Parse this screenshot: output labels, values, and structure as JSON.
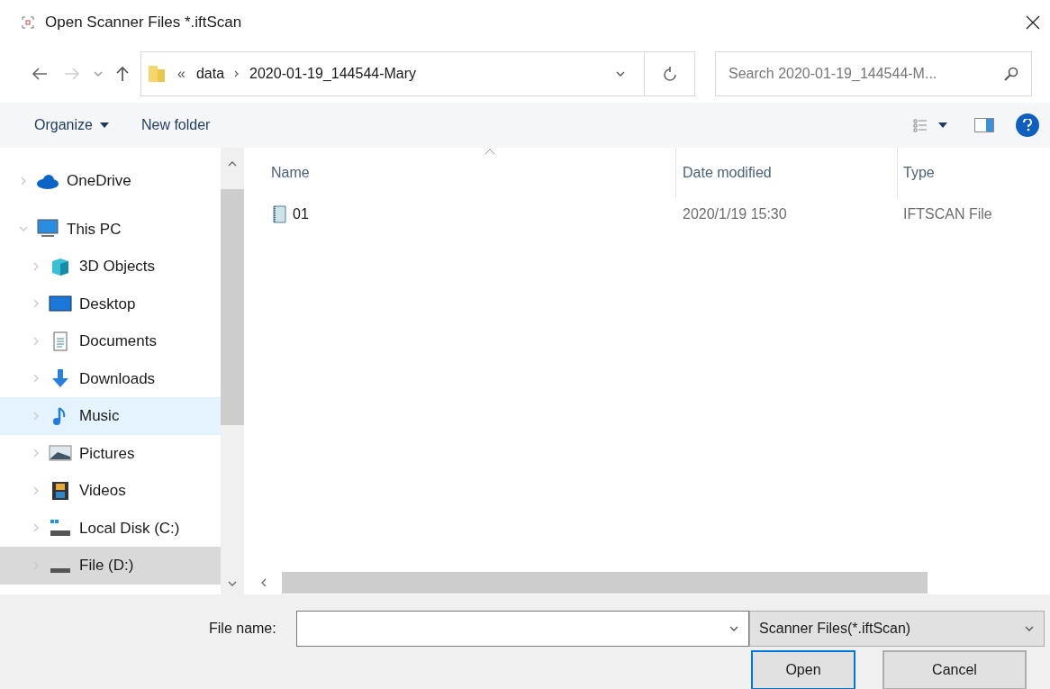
{
  "window": {
    "title": "Open Scanner Files *.iftScan"
  },
  "address_bar": {
    "overflow": "«",
    "breadcrumbs": [
      "data",
      "2020-01-19_144544-Mary"
    ]
  },
  "search": {
    "placeholder": "Search 2020-01-19_144544-M..."
  },
  "toolbar": {
    "organize": "Organize",
    "new_folder": "New folder"
  },
  "sidebar": {
    "items": [
      {
        "label": "OneDrive",
        "kind": "cloud",
        "expanded": false,
        "selected": false,
        "hovered": false
      },
      {
        "label": "This PC",
        "kind": "pc",
        "expanded": true,
        "selected": false,
        "hovered": false,
        "children": [
          {
            "label": "3D Objects",
            "kind": "cube",
            "expanded": false,
            "selected": false,
            "hovered": false
          },
          {
            "label": "Desktop",
            "kind": "desktop",
            "expanded": false,
            "selected": false,
            "hovered": false
          },
          {
            "label": "Documents",
            "kind": "document",
            "expanded": false,
            "selected": false,
            "hovered": false
          },
          {
            "label": "Downloads",
            "kind": "download",
            "expanded": false,
            "selected": false,
            "hovered": false
          },
          {
            "label": "Music",
            "kind": "music",
            "expanded": false,
            "selected": false,
            "hovered": true
          },
          {
            "label": "Pictures",
            "kind": "picture",
            "expanded": false,
            "selected": false,
            "hovered": false
          },
          {
            "label": "Videos",
            "kind": "video",
            "expanded": false,
            "selected": false,
            "hovered": false
          },
          {
            "label": "Local Disk (C:)",
            "kind": "system-drive",
            "expanded": false,
            "selected": false,
            "hovered": false
          },
          {
            "label": "File (D:)",
            "kind": "drive",
            "expanded": false,
            "selected": true,
            "hovered": false
          }
        ]
      }
    ]
  },
  "table": {
    "columns": [
      "Name",
      "Date modified",
      "Type"
    ],
    "rows": [
      {
        "name": "01",
        "date_modified": "2020/1/19 15:30",
        "type": "IFTSCAN File",
        "selected": false
      }
    ]
  },
  "footer": {
    "file_name_label": "File name:",
    "filter": "Scanner Files(*.iftScan)",
    "buttons": [
      "Open",
      "Cancel"
    ]
  }
}
